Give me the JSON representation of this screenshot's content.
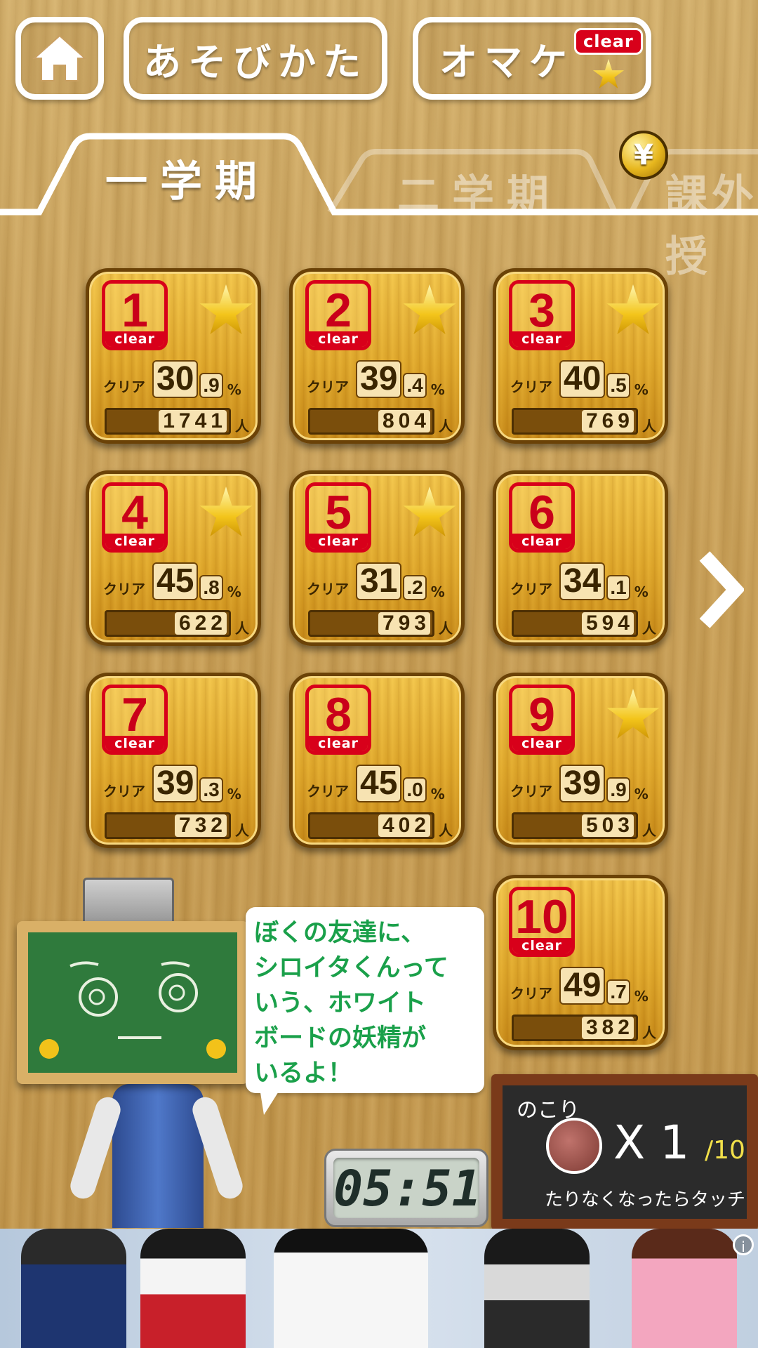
{
  "header": {
    "home_icon": "home-icon",
    "howto_label": "あそびかた",
    "omake_label": "オマケ",
    "omake_badge": "clear"
  },
  "tabs": [
    {
      "label": "一学期",
      "active": true
    },
    {
      "label": "二学期",
      "active": false
    },
    {
      "label": "課外授",
      "active": false
    }
  ],
  "coin_symbol": "¥",
  "stage_common": {
    "clear_text": "clear",
    "rate_label": "クリア",
    "percent_unit": "%",
    "people_unit": "人"
  },
  "stages": [
    {
      "num": "1",
      "star": true,
      "rate_int": "30",
      "rate_dec": ".9",
      "players": "1741"
    },
    {
      "num": "2",
      "star": true,
      "rate_int": "39",
      "rate_dec": ".4",
      "players": "804"
    },
    {
      "num": "3",
      "star": true,
      "rate_int": "40",
      "rate_dec": ".5",
      "players": "769"
    },
    {
      "num": "4",
      "star": true,
      "rate_int": "45",
      "rate_dec": ".8",
      "players": "622"
    },
    {
      "num": "5",
      "star": true,
      "rate_int": "31",
      "rate_dec": ".2",
      "players": "793"
    },
    {
      "num": "6",
      "star": false,
      "rate_int": "34",
      "rate_dec": ".1",
      "players": "594"
    },
    {
      "num": "7",
      "star": false,
      "rate_int": "39",
      "rate_dec": ".3",
      "players": "732"
    },
    {
      "num": "8",
      "star": false,
      "rate_int": "45",
      "rate_dec": ".0",
      "players": "402"
    },
    {
      "num": "9",
      "star": true,
      "rate_int": "39",
      "rate_dec": ".9",
      "players": "503"
    },
    {
      "num": "10",
      "star": false,
      "rate_int": "49",
      "rate_dec": ".7",
      "players": "382"
    }
  ],
  "speech": "ぼくの友達に、\nシロイタくんって\nいう、ホワイト\nボードの妖精が\nいるよ！",
  "timer": "05:51",
  "board": {
    "remaining_label": "のこり",
    "multiplier": "X 1",
    "total": "/10",
    "hint": "たりなくなったらタッチ"
  },
  "ad": {
    "info_icon": "info-icon",
    "info_text": "i"
  },
  "colors": {
    "accent_red": "#d8001a",
    "speech_green": "#1aa04a",
    "wood": "#c89e55"
  }
}
